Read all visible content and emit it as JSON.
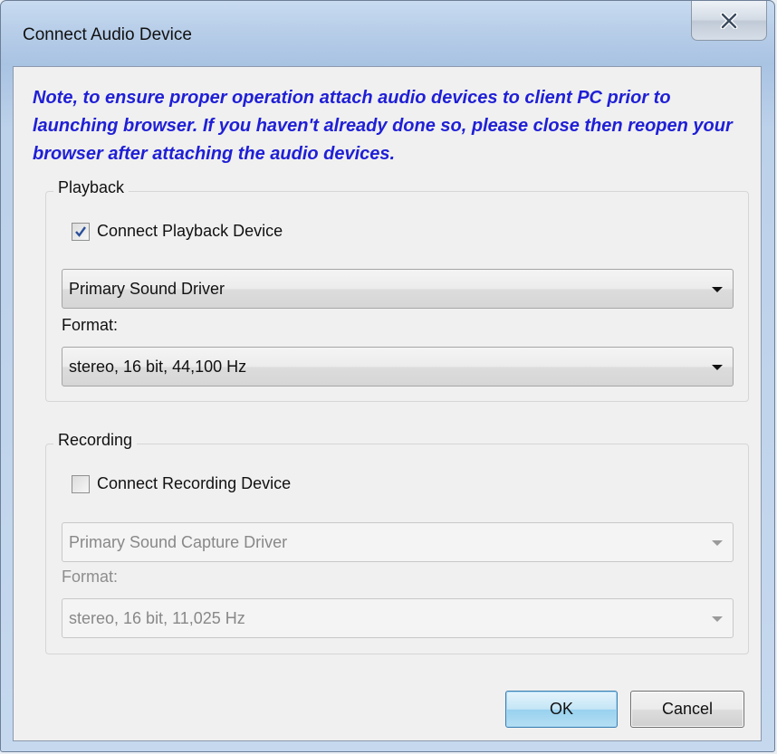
{
  "window": {
    "title": "Connect Audio Device"
  },
  "icons": {
    "close": "close-icon",
    "checkmark": "checkmark-icon",
    "dropdown_arrow": "chevron-down-icon"
  },
  "note": "Note, to ensure proper operation attach audio devices to client PC prior to launching browser. If you haven't already done so, please close then reopen your browser after attaching the audio devices.",
  "playback": {
    "group_label": "Playback",
    "checkbox_label": "Connect Playback Device",
    "checked": true,
    "device": "Primary Sound Driver",
    "format_label": "Format:",
    "format": "stereo, 16 bit, 44,100 Hz"
  },
  "recording": {
    "group_label": "Recording",
    "checkbox_label": "Connect Recording Device",
    "checked": false,
    "device": "Primary Sound Capture Driver",
    "format_label": "Format:",
    "format": "stereo, 16 bit, 11,025 Hz"
  },
  "buttons": {
    "ok": "OK",
    "cancel": "Cancel"
  },
  "colors": {
    "note_text": "#1f1fd6",
    "ok_border": "#3c7fb1"
  }
}
